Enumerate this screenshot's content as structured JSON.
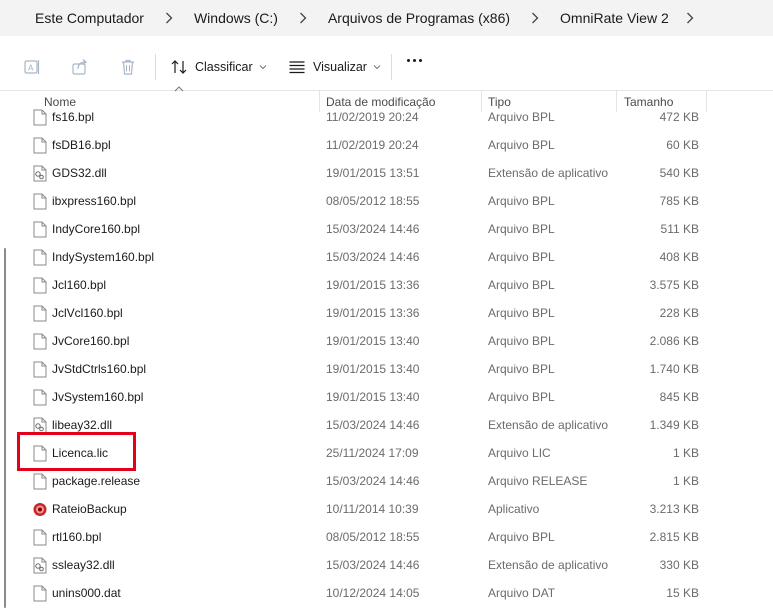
{
  "breadcrumb": {
    "items": [
      "Este Computador",
      "Windows (C:)",
      "Arquivos de Programas (x86)",
      "OmniRate View 2"
    ]
  },
  "toolbar": {
    "sort_label": "Classificar",
    "view_label": "Visualizar",
    "icons": [
      "rename-icon",
      "share-icon",
      "delete-icon",
      "sort-icon",
      "view-icon",
      "more-icon"
    ]
  },
  "columns": {
    "name": "Nome",
    "date": "Data de modificação",
    "type": "Tipo",
    "size": "Tamanho"
  },
  "files": [
    {
      "name": "fs16.bpl",
      "date": "11/02/2019 20:24",
      "type": "Arquivo BPL",
      "size": "472 KB",
      "icon": "file-icon"
    },
    {
      "name": "fsDB16.bpl",
      "date": "11/02/2019 20:24",
      "type": "Arquivo BPL",
      "size": "60 KB",
      "icon": "file-icon"
    },
    {
      "name": "GDS32.dll",
      "date": "19/01/2015 13:51",
      "type": "Extensão de aplicativo",
      "size": "540 KB",
      "icon": "dll-icon"
    },
    {
      "name": "ibxpress160.bpl",
      "date": "08/05/2012 18:55",
      "type": "Arquivo BPL",
      "size": "785 KB",
      "icon": "file-icon"
    },
    {
      "name": "IndyCore160.bpl",
      "date": "15/03/2024 14:46",
      "type": "Arquivo BPL",
      "size": "511 KB",
      "icon": "file-icon"
    },
    {
      "name": "IndySystem160.bpl",
      "date": "15/03/2024 14:46",
      "type": "Arquivo BPL",
      "size": "408 KB",
      "icon": "file-icon"
    },
    {
      "name": "Jcl160.bpl",
      "date": "19/01/2015 13:36",
      "type": "Arquivo BPL",
      "size": "3.575 KB",
      "icon": "file-icon"
    },
    {
      "name": "JclVcl160.bpl",
      "date": "19/01/2015 13:36",
      "type": "Arquivo BPL",
      "size": "228 KB",
      "icon": "file-icon"
    },
    {
      "name": "JvCore160.bpl",
      "date": "19/01/2015 13:40",
      "type": "Arquivo BPL",
      "size": "2.086 KB",
      "icon": "file-icon"
    },
    {
      "name": "JvStdCtrls160.bpl",
      "date": "19/01/2015 13:40",
      "type": "Arquivo BPL",
      "size": "1.740 KB",
      "icon": "file-icon"
    },
    {
      "name": "JvSystem160.bpl",
      "date": "19/01/2015 13:40",
      "type": "Arquivo BPL",
      "size": "845 KB",
      "icon": "file-icon"
    },
    {
      "name": "libeay32.dll",
      "date": "15/03/2024 14:46",
      "type": "Extensão de aplicativo",
      "size": "1.349 KB",
      "icon": "dll-icon"
    },
    {
      "name": "Licenca.lic",
      "date": "25/11/2024 17:09",
      "type": "Arquivo LIC",
      "size": "1 KB",
      "icon": "file-icon"
    },
    {
      "name": "package.release",
      "date": "15/03/2024 14:46",
      "type": "Arquivo RELEASE",
      "size": "1 KB",
      "icon": "file-icon"
    },
    {
      "name": "RateioBackup",
      "date": "10/11/2014 10:39",
      "type": "Aplicativo",
      "size": "3.213 KB",
      "icon": "app-icon"
    },
    {
      "name": "rtl160.bpl",
      "date": "08/05/2012 18:55",
      "type": "Arquivo BPL",
      "size": "2.815 KB",
      "icon": "file-icon"
    },
    {
      "name": "ssleay32.dll",
      "date": "15/03/2024 14:46",
      "type": "Extensão de aplicativo",
      "size": "330 KB",
      "icon": "dll-icon"
    },
    {
      "name": "unins000.dat",
      "date": "10/12/2024 14:05",
      "type": "Arquivo DAT",
      "size": "15 KB",
      "icon": "file-icon"
    }
  ],
  "highlighted_file": "Licenca.lic",
  "colors": {
    "highlight_border": "#e3001b",
    "breadcrumb_bg": "#f3f3f3",
    "secondary_text": "#6b6b6b"
  }
}
